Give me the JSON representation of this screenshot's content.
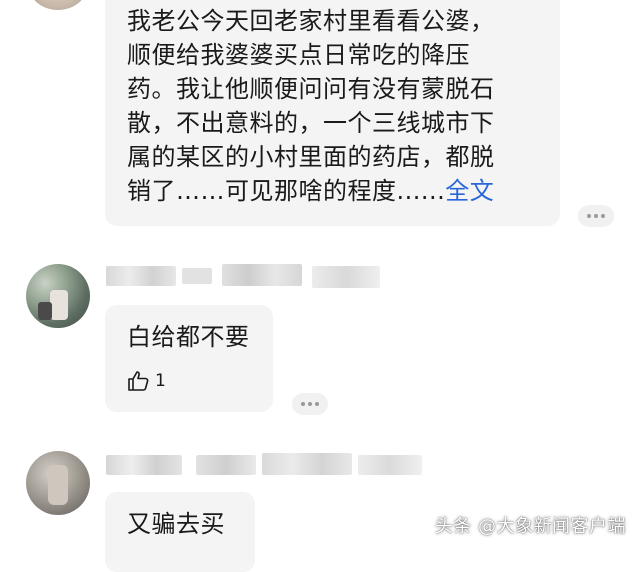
{
  "comments": [
    {
      "lines": [
        "我老公今天回老家村里看看公婆，",
        "顺便给我婆婆买点日常吃的降压",
        "药。我让他顺便问问有没有蒙脱石",
        "散，不出意料的，一个三线城市下",
        "属的某区的小村里面的药店，都脱"
      ],
      "last_line": "销了……可见那啥的程度......",
      "full_text_link": "全文"
    },
    {
      "text": "白给都不要",
      "like_count": "1"
    },
    {
      "text": "又骗去买"
    }
  ],
  "watermark": "头条 @大象新闻客户端"
}
